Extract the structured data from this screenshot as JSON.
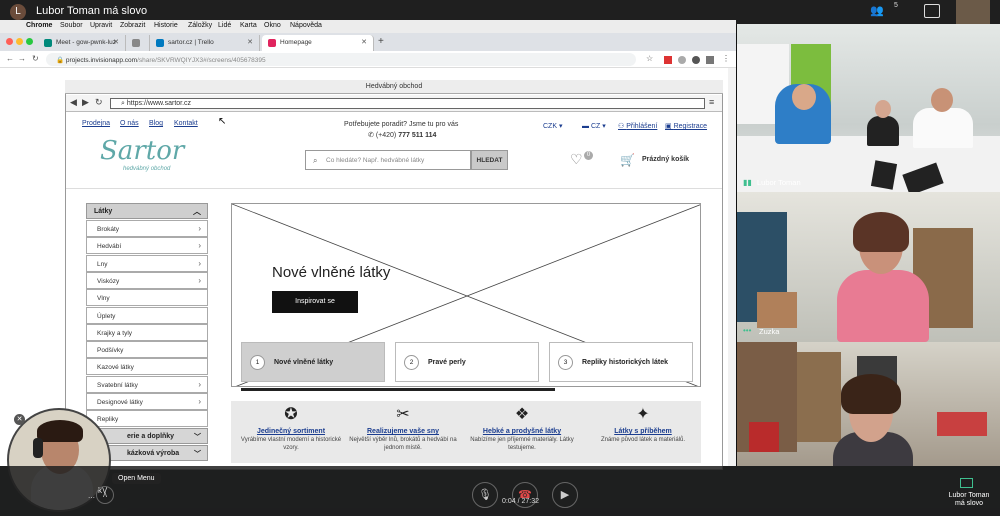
{
  "meet": {
    "initial": "L",
    "title": "Lubor Toman má slovo",
    "people_count": "5",
    "timer": "0:04 / 27:32",
    "present_label": "Lubor Toman má slovo",
    "tooltip": "Open Menu"
  },
  "mac_menu": [
    "Chrome",
    "Soubor",
    "Upravit",
    "Zobrazit",
    "Historie",
    "Záložky",
    "Lidé",
    "Karta",
    "Okno",
    "Nápověda"
  ],
  "tabs": [
    {
      "label": "Meet - gow-pwnk-luz",
      "color": "#00897b"
    },
    {
      "label": "",
      "color": "#888888"
    },
    {
      "label": "sartor.cz | Trello",
      "color": "#0079bf"
    },
    {
      "label": "Homepage",
      "color": "#e0245e"
    }
  ],
  "address": {
    "host": "projects.invisionapp.com",
    "path": "/share/SKVRWQIYJX3#/screens/405678395"
  },
  "wireframe": {
    "window_title": "Hedvábný obchod",
    "url": "https://www.sartor.cz",
    "top_links": [
      "Prodejna",
      "O nás",
      "Blog",
      "Kontakt"
    ],
    "help_text": "Potřebujete poradit? Jsme tu pro vás",
    "phone_prefix": "(+420)",
    "phone": "777 511 114",
    "currency": "CZK",
    "lang": "CZ",
    "login": "Přihlášení",
    "register": "Registrace",
    "logo": "Sartor",
    "logo_sub": "hedvábný obchod",
    "search_placeholder": "Co hledáte? Např. hedvábné látky",
    "search_button": "HLEDAT",
    "wishlist_count": "0",
    "cart": "Prázdný košík",
    "category_title": "Látky",
    "categories": [
      {
        "label": "Brokáty",
        "arrow": true
      },
      {
        "label": "Hedvábí",
        "arrow": true
      },
      {
        "label": "Lny",
        "arrow": true
      },
      {
        "label": "Viskózy",
        "arrow": true
      },
      {
        "label": "Vlny",
        "arrow": false
      },
      {
        "label": "Úplety",
        "arrow": false
      },
      {
        "label": "Krajky a tyly",
        "arrow": false
      },
      {
        "label": "Podšívky",
        "arrow": false
      },
      {
        "label": "Kazové látky",
        "arrow": false
      },
      {
        "label": "Svatební látky",
        "arrow": true
      },
      {
        "label": "Designové látky",
        "arrow": true
      },
      {
        "label": "Repliky",
        "arrow": false
      }
    ],
    "groups": [
      "erie a doplňky",
      "kázková výroba"
    ],
    "hero_title": "Nové vlněné látky",
    "hero_button": "Inspirovat se",
    "slides": [
      {
        "num": "1",
        "label": "Nové vlněné látky"
      },
      {
        "num": "2",
        "label": "Pravé perly"
      },
      {
        "num": "3",
        "label": "Repliky historických látek"
      }
    ],
    "usps": [
      {
        "icon": "✪",
        "title": "Jedinečný sortiment",
        "desc": "Vyrábíme vlastní moderní a historické vzory."
      },
      {
        "icon": "✂",
        "title": "Realizujeme vaše sny",
        "desc": "Největší výběr lnů, brokátů a hedvábí na jednom místě."
      },
      {
        "icon": "❖",
        "title": "Hebké a prodyšné látky",
        "desc": "Nabízíme jen příjemné materiály. Látky testujeme."
      },
      {
        "icon": "✦",
        "title": "Látky s příběhem",
        "desc": "Známe původ látek a materiálů."
      }
    ]
  },
  "participants": [
    {
      "name": "Lubor Toman"
    },
    {
      "name": "Zuzka"
    },
    {
      "name": ""
    }
  ],
  "self_name": "kV"
}
